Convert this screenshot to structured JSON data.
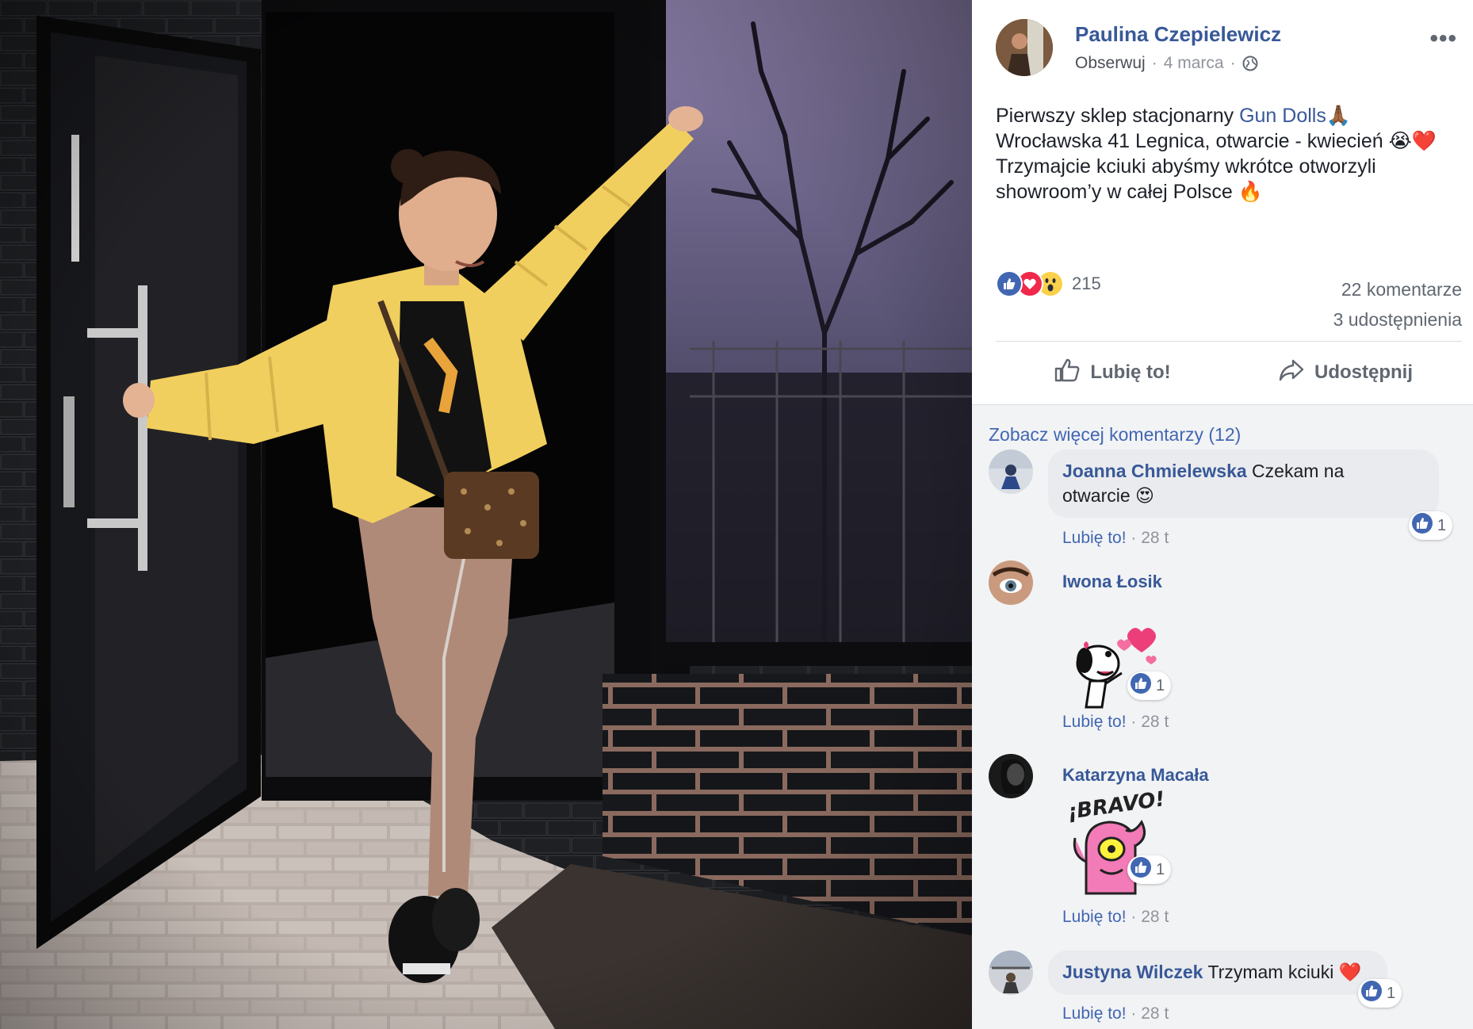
{
  "post": {
    "author": "Paulina Czepielewicz",
    "follow": "Obserwuj",
    "dot1": "·",
    "date": "4 marca",
    "dot2": "·",
    "more_icon": "more-dots-icon",
    "text_line1_prefix": "Pierwszy sklep stacjonarny ",
    "text_line1_link": "Gun Dolls",
    "text_line1_suffix": "🙏🏾",
    "text_line2": "Wrocławska 41 Legnica, otwarcie - kwiecień 😭❤️",
    "text_line3": "Trzymajcie kciuki abyśmy wkrótce otworzyli",
    "text_line4": "showroom’y w całej Polsce 🔥"
  },
  "stats": {
    "reaction_count": "215",
    "comments": "22 komentarze",
    "shares": "3 udostępnienia",
    "reaction_icons": [
      "like-icon",
      "love-icon",
      "wow-icon"
    ]
  },
  "actions": {
    "like_label": "Lubię to!",
    "share_label": "Udostępnij"
  },
  "comments": {
    "more_label": "Zobacz więcej komentarzy (12)",
    "items": [
      {
        "name": "Joanna Chmielewska",
        "text_a": " Czekam na",
        "text_b": "otwarcie 😍",
        "like_label": "Lubię to!",
        "time": "· 28 t",
        "likes": "1"
      },
      {
        "name": "Iwona Łosik",
        "sticker": "snoopy-hearts-sticker",
        "like_label": "Lubię to!",
        "time": "· 28 t",
        "likes": "1"
      },
      {
        "name": "Katarzyna Macała",
        "sticker_text": "¡BRAVO!",
        "sticker": "bravo-monster-sticker",
        "like_label": "Lubię to!",
        "time": "· 28 t",
        "likes": "1"
      },
      {
        "name": "Justyna Wilczek",
        "text_a": " Trzymam kciuki ❤️",
        "like_label": "Lubię to!",
        "time": "· 28 t",
        "likes": "1"
      }
    ]
  },
  "colors": {
    "link": "#385898",
    "like_blue": "#4267b2",
    "love_red": "#f0284a",
    "wow_yellow": "#fbd14b",
    "jacket": "#f1cf5e"
  }
}
